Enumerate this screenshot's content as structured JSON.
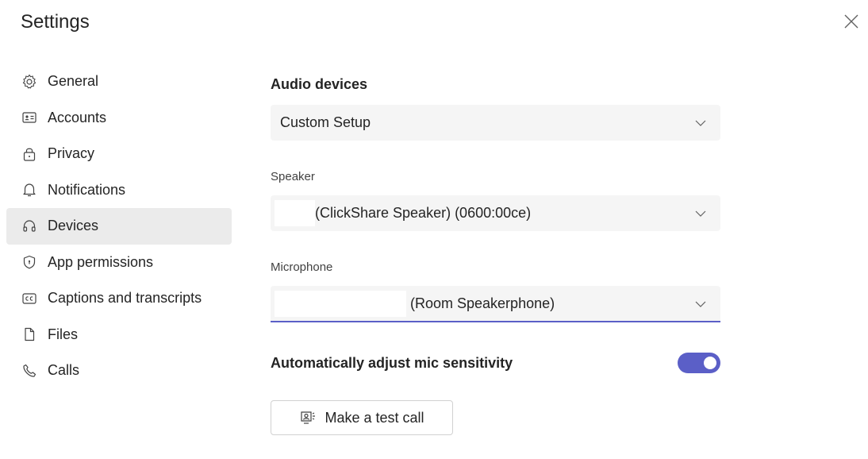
{
  "header": {
    "title": "Settings"
  },
  "sidebar": {
    "items": [
      {
        "label": "General",
        "icon": "gear-icon"
      },
      {
        "label": "Accounts",
        "icon": "id-card-icon"
      },
      {
        "label": "Privacy",
        "icon": "lock-icon"
      },
      {
        "label": "Notifications",
        "icon": "bell-icon"
      },
      {
        "label": "Devices",
        "icon": "headset-icon",
        "active": true
      },
      {
        "label": "App permissions",
        "icon": "shield-icon"
      },
      {
        "label": "Captions and transcripts",
        "icon": "cc-icon"
      },
      {
        "label": "Files",
        "icon": "file-icon"
      },
      {
        "label": "Calls",
        "icon": "phone-icon"
      }
    ]
  },
  "devices": {
    "section_title": "Audio devices",
    "audio_device": {
      "value": "Custom Setup"
    },
    "speaker": {
      "label": "Speaker",
      "value": "(ClickShare Speaker) (0600:00ce)"
    },
    "microphone": {
      "label": "Microphone",
      "value": "(Room Speakerphone)"
    },
    "auto_adjust": {
      "label": "Automatically adjust mic sensitivity",
      "enabled": true
    },
    "test_call_label": "Make a test call"
  },
  "colors": {
    "accent": "#5b5fc7",
    "active_bg": "#ebebeb",
    "dropdown_bg": "#f5f5f5"
  }
}
